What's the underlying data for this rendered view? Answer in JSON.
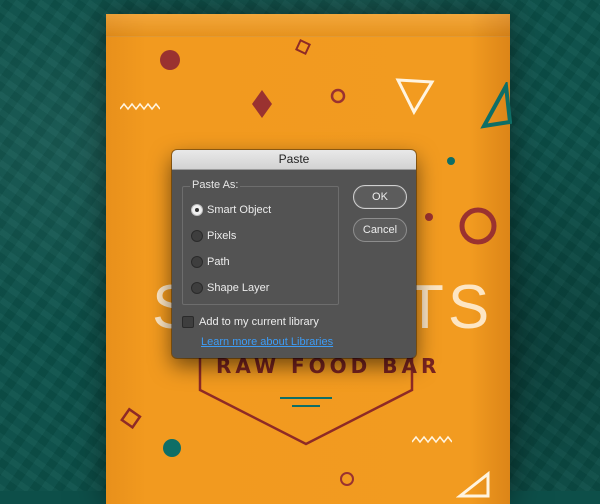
{
  "dialog": {
    "title": "Paste",
    "group_label": "Paste As:",
    "options": [
      {
        "label": "Smart Object",
        "selected": true
      },
      {
        "label": "Pixels",
        "selected": false
      },
      {
        "label": "Path",
        "selected": false
      },
      {
        "label": "Shape Layer",
        "selected": false
      }
    ],
    "ok_label": "OK",
    "cancel_label": "Cancel",
    "checkbox_label": "Add to my current library",
    "checkbox_checked": false,
    "link_label": "Learn more about Libraries"
  },
  "background": {
    "big_text_left": "S",
    "big_text_right": "TS",
    "brand_text": "RAW FOOD BAR",
    "colors": {
      "teal": "#0c524b",
      "orange": "#f29b20",
      "maroon": "#9a2e2a",
      "accent_teal": "#0e6e66",
      "link_blue": "#3d9cf5"
    }
  }
}
